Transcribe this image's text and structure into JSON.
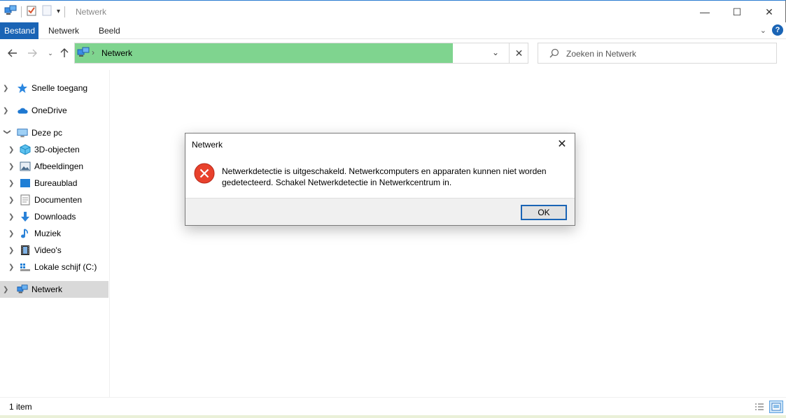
{
  "window": {
    "title": "Netwerk",
    "minimize_glyph": "—",
    "maximize_glyph": "☐",
    "close_glyph": "✕"
  },
  "ribbon": {
    "tabs": [
      "Bestand",
      "Netwerk",
      "Beeld"
    ],
    "help_glyph": "?"
  },
  "address": {
    "path": "Netwerk",
    "separator": "›"
  },
  "search": {
    "placeholder": "Zoeken in Netwerk"
  },
  "sidebar": {
    "items": [
      {
        "label": "Snelle toegang",
        "icon": "star-icon"
      },
      {
        "label": "OneDrive",
        "icon": "cloud-icon"
      },
      {
        "label": "Deze pc",
        "icon": "computer-icon"
      },
      {
        "label": "3D-objecten",
        "icon": "cube-icon"
      },
      {
        "label": "Afbeeldingen",
        "icon": "pictures-icon"
      },
      {
        "label": "Bureaublad",
        "icon": "desktop-icon"
      },
      {
        "label": "Documenten",
        "icon": "document-icon"
      },
      {
        "label": "Downloads",
        "icon": "download-icon"
      },
      {
        "label": "Muziek",
        "icon": "music-icon"
      },
      {
        "label": "Video's",
        "icon": "video-icon"
      },
      {
        "label": "Lokale schijf (C:)",
        "icon": "drive-icon"
      },
      {
        "label": "Netwerk",
        "icon": "network-icon"
      }
    ]
  },
  "status": {
    "count": "1 item"
  },
  "dialog": {
    "title": "Netwerk",
    "message": "Netwerkdetectie is uitgeschakeld. Netwerkcomputers en apparaten kunnen niet worden gedetecteerd. Schakel Netwerkdetectie in Netwerkcentrum in.",
    "ok_label": "OK",
    "close_glyph": "✕"
  },
  "colors": {
    "accent": "#1a64b5",
    "address_highlight": "#7fd48f",
    "error_red": "#e8412c"
  }
}
